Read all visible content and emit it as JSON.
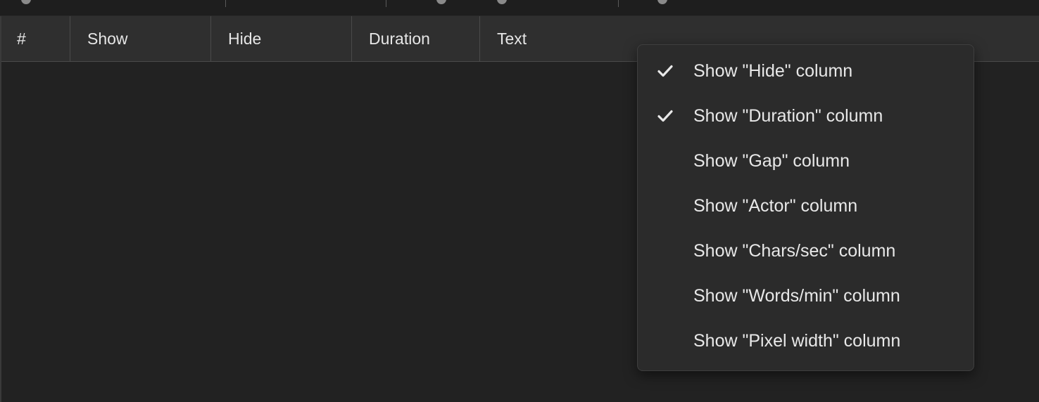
{
  "columns": [
    {
      "label": "#"
    },
    {
      "label": "Show"
    },
    {
      "label": "Hide"
    },
    {
      "label": "Duration"
    },
    {
      "label": "Text"
    }
  ],
  "context_menu": {
    "items": [
      {
        "label": "Show \"Hide\" column",
        "checked": true
      },
      {
        "label": "Show \"Duration\" column",
        "checked": true
      },
      {
        "label": "Show \"Gap\" column",
        "checked": false
      },
      {
        "label": "Show \"Actor\" column",
        "checked": false
      },
      {
        "label": "Show \"Chars/sec\" column",
        "checked": false
      },
      {
        "label": "Show \"Words/min\" column",
        "checked": false
      },
      {
        "label": "Show \"Pixel width\" column",
        "checked": false
      }
    ]
  },
  "icons": {
    "checkmark": "checkmark-icon"
  },
  "colors": {
    "background": "#222222",
    "header": "#2f2f2f",
    "menu": "#2b2b2b",
    "text": "#e6e6e6"
  }
}
